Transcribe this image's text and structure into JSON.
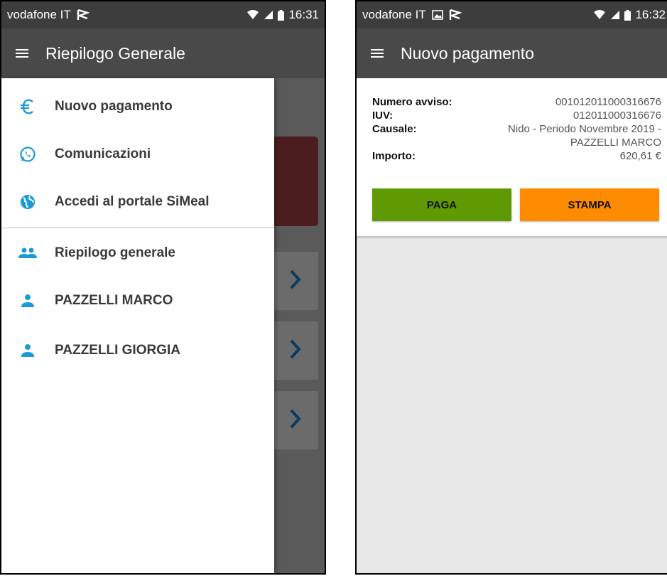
{
  "left_screen": {
    "status": {
      "carrier": "vodafone IT",
      "time": "16:31"
    },
    "appbar": {
      "title": "Riepilogo Generale"
    },
    "drawer": {
      "items": [
        {
          "label": "Nuovo pagamento",
          "icon": "euro-icon"
        },
        {
          "label": "Comunicazioni",
          "icon": "whatsapp-icon"
        },
        {
          "label": "Accedi al portale SiMeal",
          "icon": "globe-icon"
        },
        {
          "label": "Riepilogo generale",
          "icon": "people-icon"
        },
        {
          "label": "PAZZELLI MARCO",
          "icon": "person-icon"
        },
        {
          "label": "PAZZELLI GIORGIA",
          "icon": "person-icon"
        }
      ]
    }
  },
  "right_screen": {
    "status": {
      "carrier": "vodafone IT",
      "time": "16:32"
    },
    "appbar": {
      "title": "Nuovo pagamento"
    },
    "payment": {
      "numero_avviso_label": "Numero avviso:",
      "numero_avviso": "001012011000316676",
      "iuv_label": "IUV:",
      "iuv": "012011000316676",
      "causale_label": "Causale:",
      "causale_line1": "Nido - Periodo Novembre 2019 -",
      "causale_line2": "PAZZELLI MARCO",
      "importo_label": "Importo:",
      "importo": "620,61 €"
    },
    "buttons": {
      "paga": "PAGA",
      "stampa": "STAMPA"
    }
  },
  "colors": {
    "accent_blue": "#1a9bd7",
    "paga_green": "#5f9a03",
    "stampa_orange": "#ff8b00",
    "appbar": "#494949",
    "statusbar": "#3d3d3d"
  }
}
